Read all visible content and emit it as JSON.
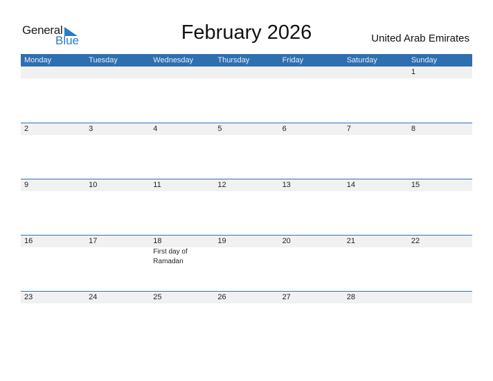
{
  "logo": {
    "general": "General",
    "blue": "Blue"
  },
  "header": {
    "title": "February 2026",
    "country": "United Arab Emirates"
  },
  "colors": {
    "accent": "#2e6fb0",
    "band": "#f1f1f1"
  },
  "days": [
    "Monday",
    "Tuesday",
    "Wednesday",
    "Thursday",
    "Friday",
    "Saturday",
    "Sunday"
  ],
  "weeks": [
    {
      "cells": [
        {
          "num": "",
          "event": ""
        },
        {
          "num": "",
          "event": ""
        },
        {
          "num": "",
          "event": ""
        },
        {
          "num": "",
          "event": ""
        },
        {
          "num": "",
          "event": ""
        },
        {
          "num": "",
          "event": ""
        },
        {
          "num": "1",
          "event": ""
        }
      ]
    },
    {
      "cells": [
        {
          "num": "2",
          "event": ""
        },
        {
          "num": "3",
          "event": ""
        },
        {
          "num": "4",
          "event": ""
        },
        {
          "num": "5",
          "event": ""
        },
        {
          "num": "6",
          "event": ""
        },
        {
          "num": "7",
          "event": ""
        },
        {
          "num": "8",
          "event": ""
        }
      ]
    },
    {
      "cells": [
        {
          "num": "9",
          "event": ""
        },
        {
          "num": "10",
          "event": ""
        },
        {
          "num": "11",
          "event": ""
        },
        {
          "num": "12",
          "event": ""
        },
        {
          "num": "13",
          "event": ""
        },
        {
          "num": "14",
          "event": ""
        },
        {
          "num": "15",
          "event": ""
        }
      ]
    },
    {
      "cells": [
        {
          "num": "16",
          "event": ""
        },
        {
          "num": "17",
          "event": ""
        },
        {
          "num": "18",
          "event": "First day of Ramadan"
        },
        {
          "num": "19",
          "event": ""
        },
        {
          "num": "20",
          "event": ""
        },
        {
          "num": "21",
          "event": ""
        },
        {
          "num": "22",
          "event": ""
        }
      ]
    },
    {
      "cells": [
        {
          "num": "23",
          "event": ""
        },
        {
          "num": "24",
          "event": ""
        },
        {
          "num": "25",
          "event": ""
        },
        {
          "num": "26",
          "event": ""
        },
        {
          "num": "27",
          "event": ""
        },
        {
          "num": "28",
          "event": ""
        },
        {
          "num": "",
          "event": ""
        }
      ]
    }
  ]
}
